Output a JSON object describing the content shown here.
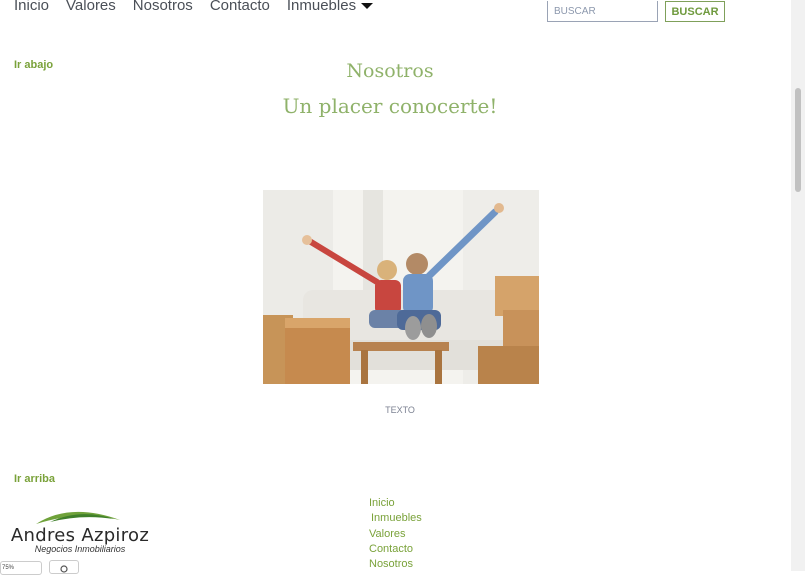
{
  "nav": {
    "items": [
      "Inicio",
      "Valores",
      "Nosotros",
      "Contacto",
      "Inmuebles"
    ]
  },
  "search": {
    "placeholder": "BUSCAR",
    "button_label": "BUSCAR"
  },
  "page": {
    "ir_abajo": "Ir abajo",
    "title": "Nosotros",
    "subtitle": "Un placer conocerte!",
    "caption": "TEXTO",
    "ir_arriba": "Ir arriba"
  },
  "footer": {
    "nav": [
      "Inicio",
      "Inmuebles",
      "Valores",
      "Contacto",
      "Nosotros"
    ],
    "logo_name": "Andres Azpiroz",
    "logo_sub": "Negocios Inmobiliarios"
  },
  "status": {
    "zoom": "75%"
  },
  "colors": {
    "accent": "#7aa23a",
    "heading": "#8fb26a",
    "nav_text": "#4a4f57"
  }
}
